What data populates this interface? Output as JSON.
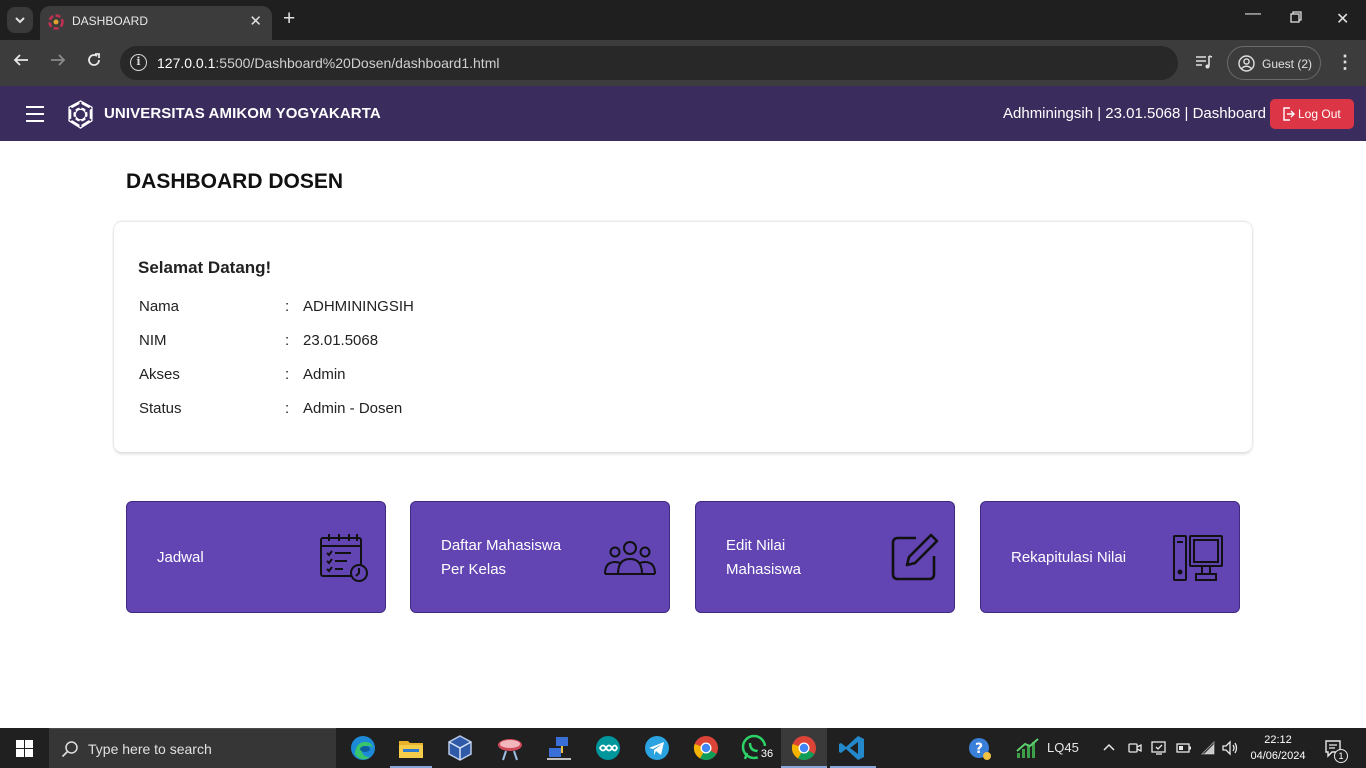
{
  "browser": {
    "tab_title": "DASHBOARD",
    "url_host": "127.0.0.1",
    "url_path": ":5500/Dashboard%20Dosen/dashboard1.html",
    "profile_label": "Guest (2)"
  },
  "navbar": {
    "brand": "UNIVERSITAS AMIKOM YOGYAKARTA",
    "user_info": "Adhminingsih | 23.01.5068 | Dashboard",
    "logout_label": "Log Out"
  },
  "page": {
    "title": "DASHBOARD DOSEN"
  },
  "profile_card": {
    "greeting": "Selamat Datang!",
    "rows": [
      {
        "label": "Nama",
        "sep": ":",
        "value": "ADHMININGSIH"
      },
      {
        "label": "NIM",
        "sep": ":",
        "value": "23.01.5068"
      },
      {
        "label": "Akses",
        "sep": ":",
        "value": "Admin"
      },
      {
        "label": "Status",
        "sep": ":",
        "value": "Admin - Dosen"
      }
    ]
  },
  "menu": [
    {
      "line1": "Jadwal",
      "line2": "",
      "icon": "calendar-schedule-icon"
    },
    {
      "line1": "Daftar Mahasiswa",
      "line2": "Per Kelas",
      "icon": "people-group-icon"
    },
    {
      "line1": "Edit Nilai",
      "line2": "Mahasiswa",
      "icon": "pencil-square-icon"
    },
    {
      "line1": "Rekapitulasi Nilai",
      "line2": "",
      "icon": "desktop-computer-icon"
    }
  ],
  "taskbar": {
    "search_placeholder": "Type here to search",
    "whatsapp_badge": "36",
    "stock_label": "LQ45",
    "time": "22:12",
    "date": "04/06/2024",
    "notification_count": "1"
  },
  "colors": {
    "navbar_bg": "#3b2c5e",
    "menu_card_bg": "#6244b3",
    "logout_bg": "#dc3545"
  }
}
